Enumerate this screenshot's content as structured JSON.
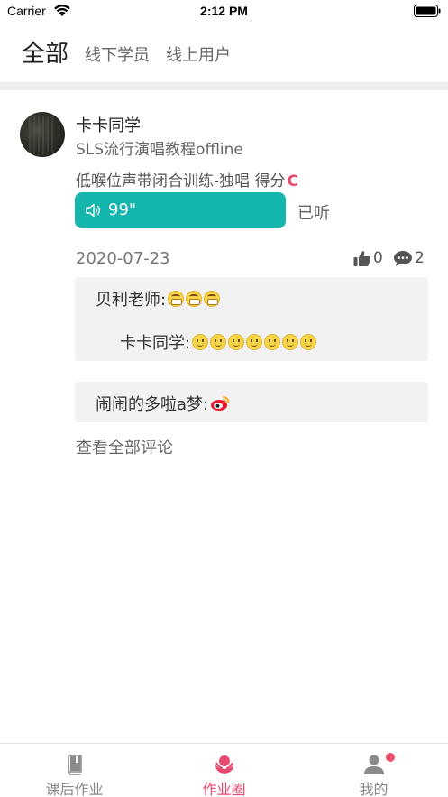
{
  "status_bar": {
    "carrier": "Carrier",
    "time": "2:12 PM"
  },
  "tabs": [
    {
      "label": "全部",
      "active": true
    },
    {
      "label": "线下学员",
      "active": false
    },
    {
      "label": "线上用户",
      "active": false
    }
  ],
  "post": {
    "user_name": "卡卡同学",
    "course": "SLS流行演唱教程offline",
    "lesson": "低喉位声带闭合训练-独唱",
    "score_label": "得分",
    "grade": "C",
    "audio_duration": "99\"",
    "listened_label": "已听",
    "date": "2020-07-23",
    "likes": "0",
    "comments_count": "2",
    "comments": [
      {
        "author": "贝利老师:",
        "emoji": "grin",
        "emoji_count": 3
      },
      {
        "author": "卡卡同学:",
        "emoji": "smile",
        "emoji_count": 7
      },
      {
        "author": "闹闹的多啦a梦:",
        "emoji": "weibo",
        "emoji_count": 1
      }
    ],
    "view_all_comments": "查看全部评论"
  },
  "bottom_nav": [
    {
      "label": "课后作业",
      "icon": "book-icon",
      "active": false
    },
    {
      "label": "作业圈",
      "icon": "circle-hands-icon",
      "active": true
    },
    {
      "label": "我的",
      "icon": "person-icon",
      "active": false
    }
  ],
  "colors": {
    "accent": "#e84a6f",
    "audio_bar": "#14b5ad"
  }
}
